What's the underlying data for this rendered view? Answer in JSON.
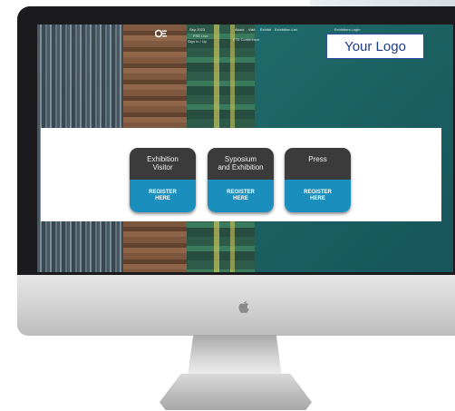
{
  "nav": {
    "date": "Sep 2023",
    "about": "About",
    "visit": "Visit",
    "exhibit": "Exhibit",
    "exhibition_list": "Exhibition List",
    "register": "Exhibitors Login",
    "sub_1": "PSE Live",
    "sub_2": "Sign In / Up",
    "sub_3": "FTE Conference"
  },
  "logo_placeholder": "Your Logo",
  "cards": [
    {
      "title_line1": "Exhibition",
      "title_line2": "Visitor",
      "cta_line1": "REGISTER",
      "cta_line2": "HERE"
    },
    {
      "title_line1": "Syposium",
      "title_line2": "and Exhibition",
      "cta_line1": "REGISTER",
      "cta_line2": "HERE"
    },
    {
      "title_line1": "Press",
      "title_line2": "",
      "cta_line1": "REGISTER",
      "cta_line2": "HERE"
    }
  ],
  "colors": {
    "card_header": "#3b3b3b",
    "card_cta": "#1a8fbe",
    "logo_border": "#2f4aa5",
    "logo_text": "#1e3a8a"
  },
  "icons": {
    "monitor_badge": "apple-icon",
    "site_logo": "brand-logo-icon"
  }
}
